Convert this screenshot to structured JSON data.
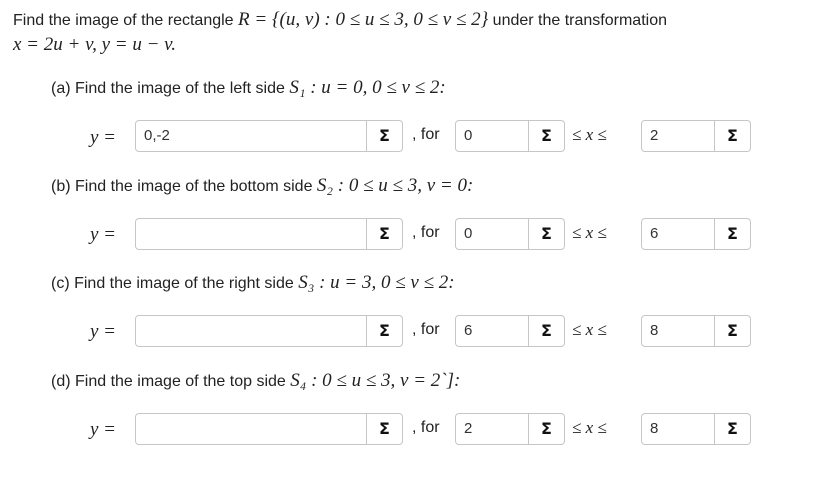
{
  "intro": {
    "line1_text": "Find the image of the rectangle",
    "line1_math": "R = {(u, v) : 0 ≤ u ≤ 3, 0 ≤ v ≤ 2}",
    "line1_tail": "under the transformation",
    "line2_math": "x = 2u + v, y = u − v."
  },
  "parts": [
    {
      "label": "(a) Find the image of the left side",
      "math": "S₁ : u = 0, 0 ≤ v ≤ 2:",
      "y_value": "0,-2",
      "from_value": "0",
      "to_value": "2"
    },
    {
      "label": "(b) Find the image of the bottom side",
      "math": "S₂ : 0 ≤ u ≤ 3, v = 0:",
      "y_value": "",
      "from_value": "0",
      "to_value": "6"
    },
    {
      "label": "(c) Find the image of the right side",
      "math": "S₃ : u = 3, 0 ≤ v ≤ 2:",
      "y_value": "",
      "from_value": "6",
      "to_value": "8"
    },
    {
      "label": "(d) Find the image of the top side",
      "math": "S₄ : 0 ≤ u ≤ 3, v = 2`]:",
      "y_value": "",
      "from_value": "2",
      "to_value": "8"
    }
  ],
  "labels": {
    "y_eq": "y =",
    "for": ", for",
    "ineq": "≤ x ≤",
    "sigma": "Σ"
  }
}
